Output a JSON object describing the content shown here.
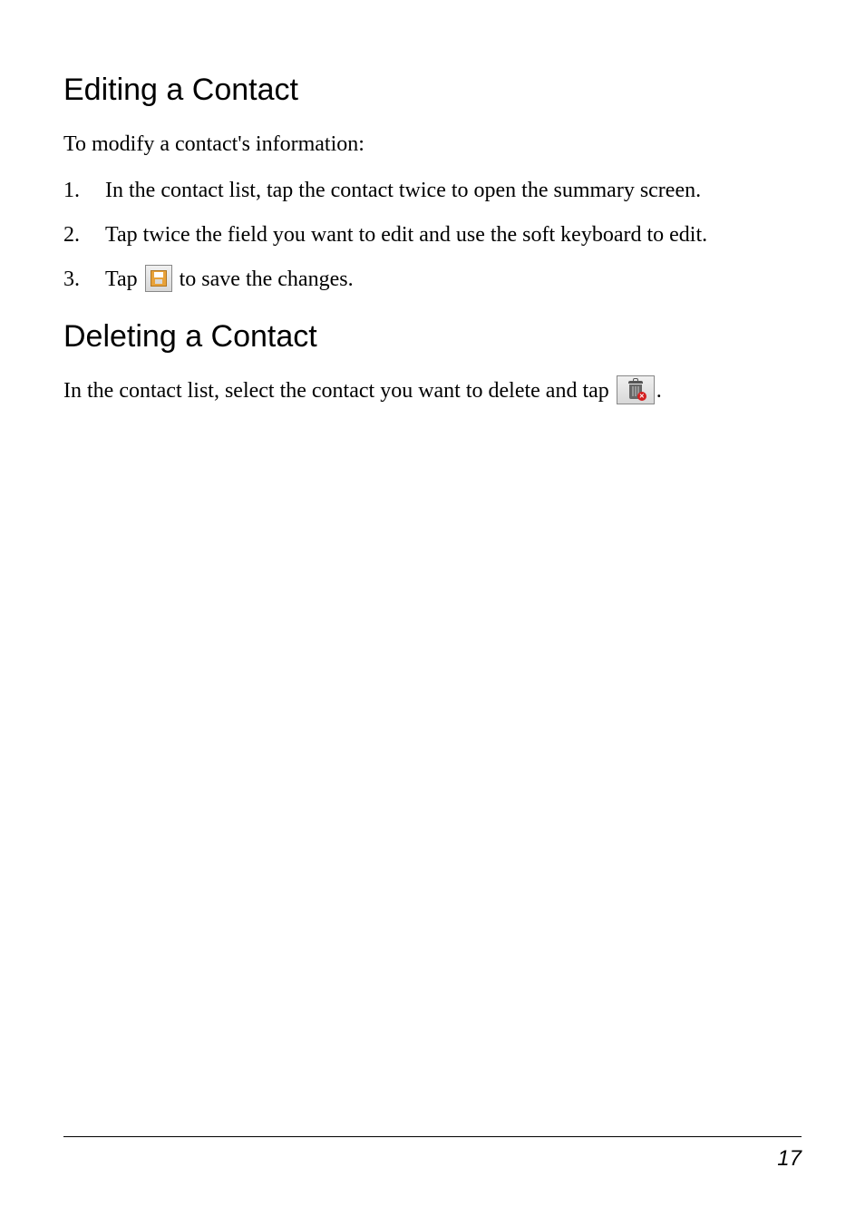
{
  "headings": {
    "editing": "Editing a Contact",
    "deleting": "Deleting a Contact"
  },
  "paragraphs": {
    "intro": "To modify a contact's information:",
    "delete_before": "In the contact list, select the contact you want to delete and tap ",
    "delete_after": "."
  },
  "list": {
    "item1": "In the contact list, tap the contact twice to open the summary screen.",
    "item2": "Tap twice the field you want to edit and use the soft keyboard to edit.",
    "item3_before": "Tap ",
    "item3_after": " to save the changes."
  },
  "icons": {
    "save": "save-icon",
    "delete": "trash-delete-icon"
  },
  "footer": {
    "page_number": "17"
  }
}
